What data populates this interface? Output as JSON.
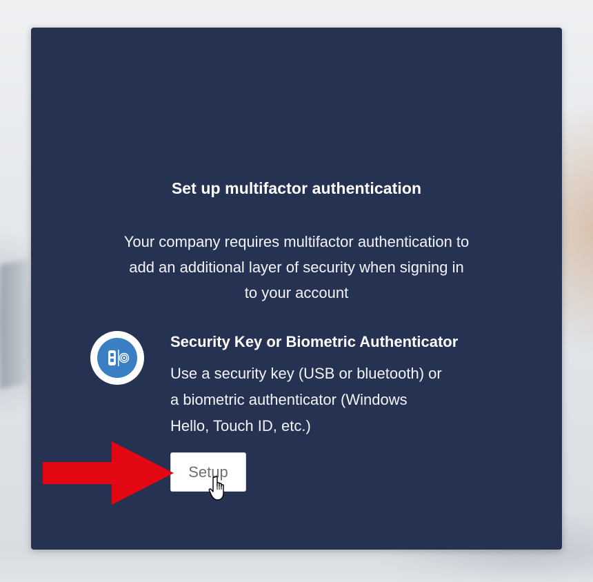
{
  "dialog": {
    "title": "Set up multifactor authentication",
    "description_lines": [
      "Your company requires multifactor authentication to",
      "add an additional layer of security when signing in",
      "to your account"
    ]
  },
  "factor": {
    "icon": "security-key-biometric-icon",
    "title": "Security Key or Biometric Authenticator",
    "description_lines": [
      "Use a security key (USB or bluetooth) or",
      "a biometric authenticator (Windows",
      "Hello, Touch ID, etc.)"
    ],
    "setup_label": "Setup"
  },
  "annotation": {
    "arrow": "red-arrow-icon",
    "cursor": "hand-pointer-icon"
  },
  "colors": {
    "card_background": "#263252",
    "icon_blue": "#3a7fc4",
    "arrow_red": "#e30613",
    "text": "#ffffff",
    "button_text": "#6b7077"
  }
}
